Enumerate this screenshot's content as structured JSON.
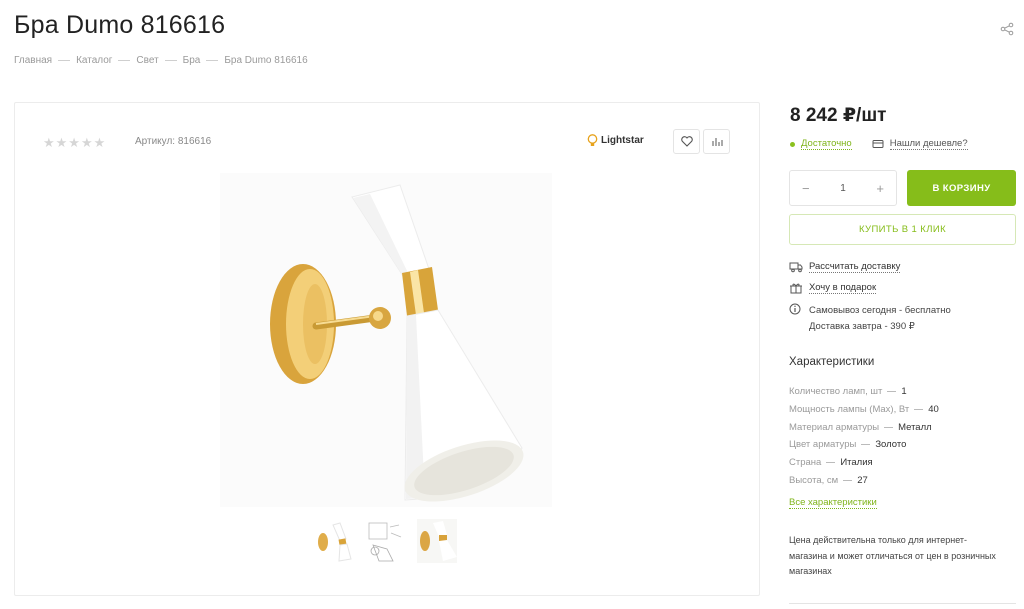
{
  "product": {
    "title": "Бра Dumo 816616",
    "sku": "Артикул: 816616",
    "brand": "Lightstar",
    "rating_stars": "★★★★★",
    "rating": 0
  },
  "breadcrumb": [
    "Главная",
    "Каталог",
    "Свет",
    "Бра",
    "Бра Dumo 816616"
  ],
  "buy": {
    "price": "8 242 ₽/шт",
    "stock": "Достаточно",
    "cheaper": "Нашли дешевле?",
    "qty_minus": "−",
    "qty_value": "1",
    "qty_plus": "+",
    "cart": "В КОРЗИНУ",
    "one_click": "КУПИТЬ В 1 КЛИК"
  },
  "delivery": {
    "calc": "Рассчитать доставку",
    "gift": "Хочу в подарок",
    "pickup": "Самовывоз сегодня - бесплатно",
    "courier": "Доставка завтра - 390 ₽"
  },
  "characteristics": {
    "title": "Характеристики",
    "items": [
      {
        "k": "Количество ламп, шт",
        "v": "1"
      },
      {
        "k": "Мощность лампы (Max), Вт",
        "v": "40"
      },
      {
        "k": "Материал арматуры",
        "v": "Металл"
      },
      {
        "k": "Цвет арматуры",
        "v": "Золото"
      },
      {
        "k": "Страна",
        "v": "Италия"
      },
      {
        "k": "Высота, см",
        "v": "27"
      }
    ],
    "all": "Все характеристики"
  },
  "note": "Цена действительна только для интернет-магазина и может отличаться от цен в розничных магазинах",
  "colors": {
    "accent": "#86bd1a",
    "gold": "#d4a233"
  }
}
